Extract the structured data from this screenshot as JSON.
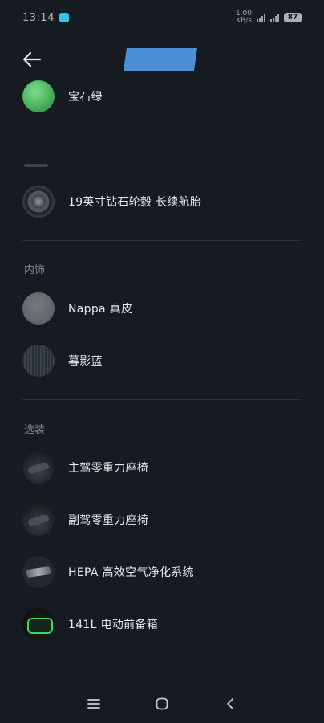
{
  "status_bar": {
    "time": "13:14",
    "battery": "87",
    "net_speed": "1.00\nKB/s"
  },
  "header": {
    "back_icon": "arrow-left-icon"
  },
  "exterior": {
    "items": [
      {
        "label": "宝石绿",
        "icon": "color-swatch-green"
      },
      {
        "label": "19英寸钻石轮毂 长续航胎",
        "icon": "wheel-thumbnail"
      }
    ]
  },
  "interior": {
    "title": "内饰",
    "items": [
      {
        "label": "Nappa 真皮",
        "icon": "leather-swatch"
      },
      {
        "label": "暮影蓝",
        "icon": "trim-swatch"
      }
    ]
  },
  "options": {
    "title": "选装",
    "items": [
      {
        "label": "主驾零重力座椅",
        "icon": "seat-thumbnail"
      },
      {
        "label": "副驾零重力座椅",
        "icon": "seat-thumbnail"
      },
      {
        "label": "HEPA 高效空气净化系统",
        "icon": "air-filter-thumbnail"
      },
      {
        "label": "141L 电动前备箱",
        "icon": "frunk-thumbnail"
      }
    ]
  },
  "nav": {
    "menu_icon": "menu-icon",
    "home_icon": "home-icon",
    "back_icon": "back-chevron-icon"
  },
  "colors": {
    "background": "#161a21",
    "text": "#e8eaee",
    "section_title": "#7c838f",
    "divider": "#2a2f38",
    "gem_green": "#49b15c"
  }
}
